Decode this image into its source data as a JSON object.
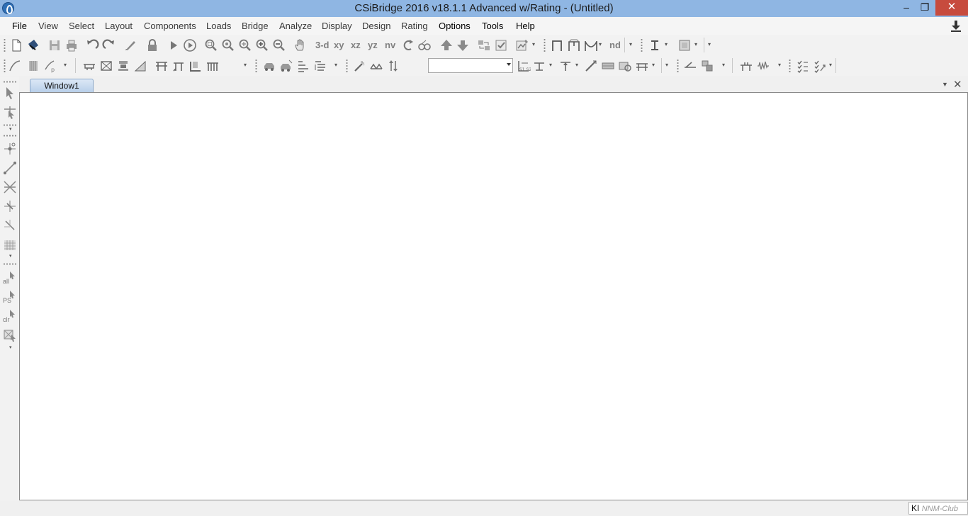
{
  "window": {
    "title": "CSiBridge 2016 v18.1.1 Advanced w/Rating  - (Untitled)",
    "minimize_glyph": "–",
    "maximize_glyph": "❐",
    "close_glyph": "✕"
  },
  "menu": [
    {
      "label": "File"
    },
    {
      "label": "View"
    },
    {
      "label": "Select"
    },
    {
      "label": "Layout"
    },
    {
      "label": "Components"
    },
    {
      "label": "Loads"
    },
    {
      "label": "Bridge"
    },
    {
      "label": "Analyze"
    },
    {
      "label": "Display"
    },
    {
      "label": "Design"
    },
    {
      "label": "Rating"
    },
    {
      "label": "Options"
    },
    {
      "label": "Tools"
    },
    {
      "label": "Help"
    }
  ],
  "toolbar_view": {
    "view_3d": "3-d",
    "view_xy": "xy",
    "view_xz": "xz",
    "view_yz": "yz",
    "view_nv": "nv",
    "view_nd": "nd"
  },
  "document_tab": {
    "label": "Window1"
  },
  "left_toolbar": {
    "select_all": "all",
    "select_ps": "PS",
    "clear_selection": "clr"
  },
  "status": {
    "units": "KI",
    "watermark": "NNM-Club"
  },
  "colors": {
    "titlebar": "#8fb6e3",
    "close_button": "#c74b3e",
    "tab_active": "#b8cfe9",
    "icon_gray": "#7a7a7a"
  }
}
